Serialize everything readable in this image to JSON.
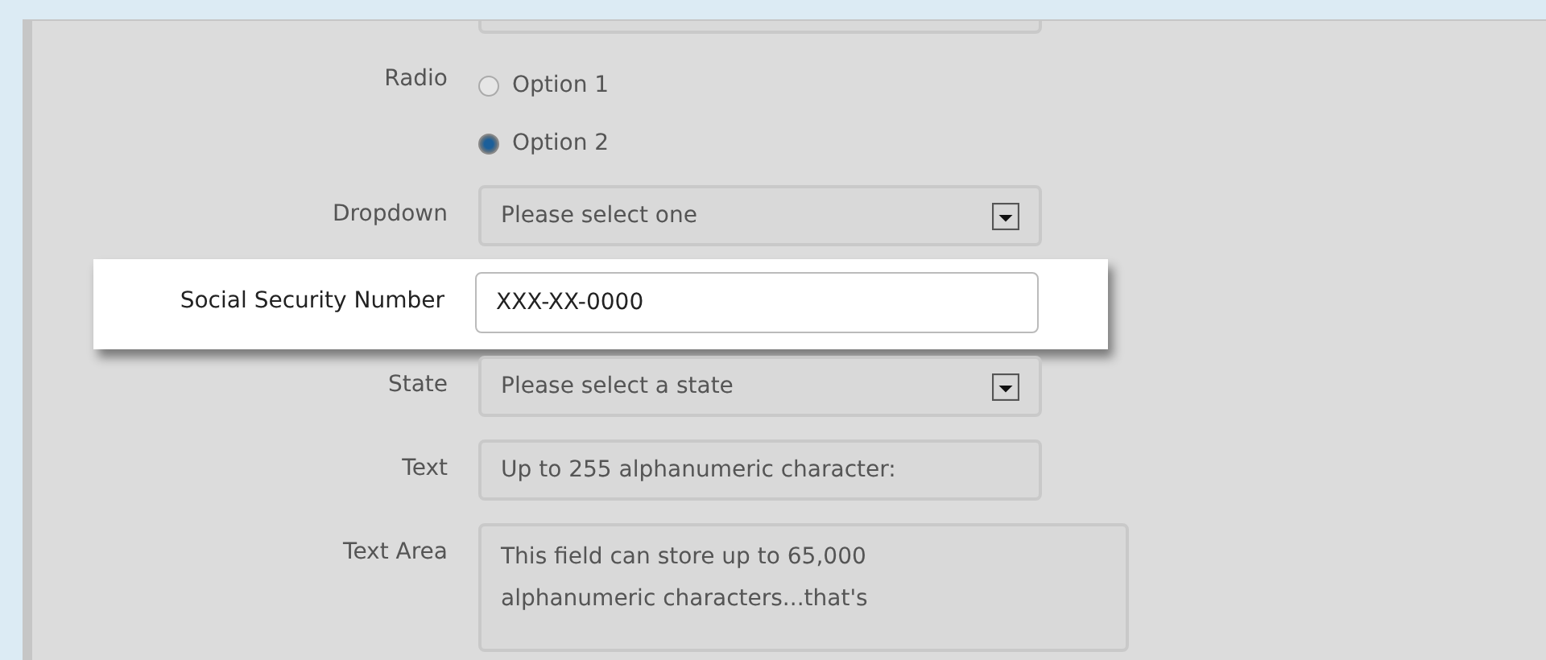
{
  "fields": [
    {
      "kind": "cut"
    },
    {
      "kind": "radio",
      "label": "Radio",
      "highlighted": false,
      "options": [
        {
          "label": "Option 1",
          "selected": false
        },
        {
          "label": "Option 2",
          "selected": true
        }
      ]
    },
    {
      "kind": "select",
      "label": "Dropdown",
      "value": "Please select one",
      "highlighted": false
    },
    {
      "kind": "text",
      "label": "Social Security Number",
      "value": "XXX-XX-0000",
      "highlighted": true
    },
    {
      "kind": "select",
      "label": "State",
      "value": "Please select a state",
      "highlighted": false
    },
    {
      "kind": "text",
      "label": "Text",
      "value": "Up to 255 alphanumeric character:",
      "highlighted": false
    },
    {
      "kind": "textarea",
      "label": "Text Area",
      "value": "This field can store up to 65,000 alphanumeric characters...that's",
      "highlighted": false
    }
  ]
}
